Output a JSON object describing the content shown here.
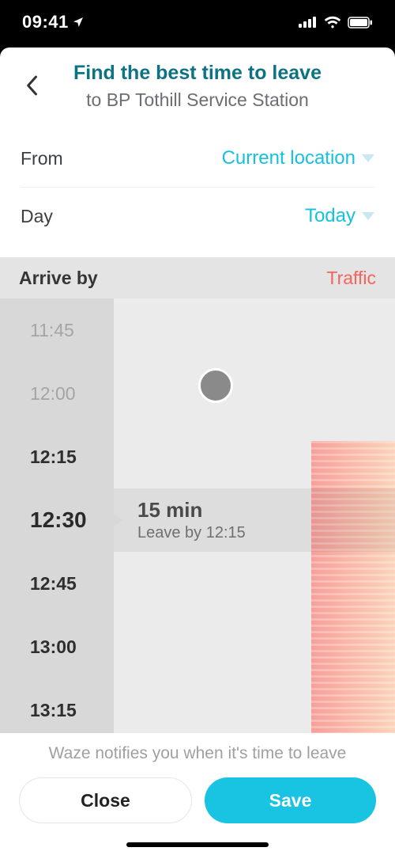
{
  "statusbar": {
    "time": "09:41"
  },
  "header": {
    "title": "Find the best time to leave",
    "subtitle": "to BP Tothill Service Station"
  },
  "from": {
    "label": "From",
    "value": "Current location"
  },
  "day": {
    "label": "Day",
    "value": "Today"
  },
  "picker": {
    "arrive_label": "Arrive by",
    "traffic_label": "Traffic",
    "times": [
      "11:45",
      "12:00",
      "12:15",
      "12:30",
      "12:45",
      "13:00",
      "13:15"
    ],
    "selected_index": 3,
    "duration": "15 min",
    "leave_by": "Leave by 12:15"
  },
  "footer": {
    "notice": "Waze notifies you when it's time to leave",
    "close": "Close",
    "save": "Save"
  },
  "chart_data": {
    "type": "bar",
    "note": "Traffic intensity by arrival time; bar width = relative intensity (0-100). Values estimated from gradient fill width.",
    "categories": [
      "11:45",
      "12:00",
      "12:15",
      "12:30",
      "12:45",
      "13:00",
      "13:15"
    ],
    "values": [
      0,
      0,
      100,
      100,
      100,
      100,
      100
    ],
    "selected_category": "12:30"
  }
}
